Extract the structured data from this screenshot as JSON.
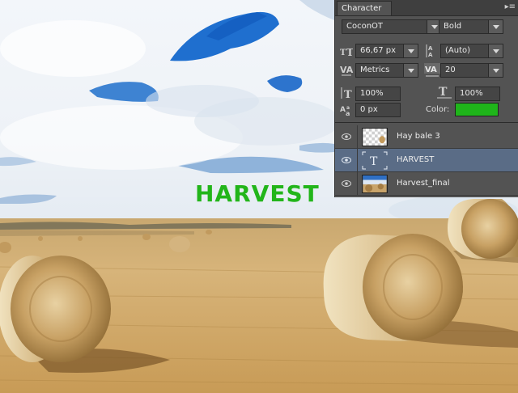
{
  "canvas": {
    "overlay_text": "HARVEST",
    "overlay_color": "#22b51a"
  },
  "character_panel": {
    "tab_label": "Character",
    "font_family": "CoconOT",
    "font_style": "Bold",
    "font_size": "66,67 px",
    "leading": "(Auto)",
    "kerning": "Metrics",
    "tracking": "20",
    "vertical_scale": "100%",
    "horizontal_scale": "100%",
    "baseline_shift": "0 px",
    "color_label": "Color:",
    "text_color": "#1fb51a",
    "menu_icon": "panel-menu-icon"
  },
  "layers_panel": {
    "layers": [
      {
        "name": "Hay bale 3",
        "type": "image",
        "visible": true,
        "selected": false
      },
      {
        "name": "HARVEST",
        "type": "text",
        "visible": true,
        "selected": true
      },
      {
        "name": "Harvest_final",
        "type": "image",
        "visible": true,
        "selected": false
      }
    ]
  }
}
